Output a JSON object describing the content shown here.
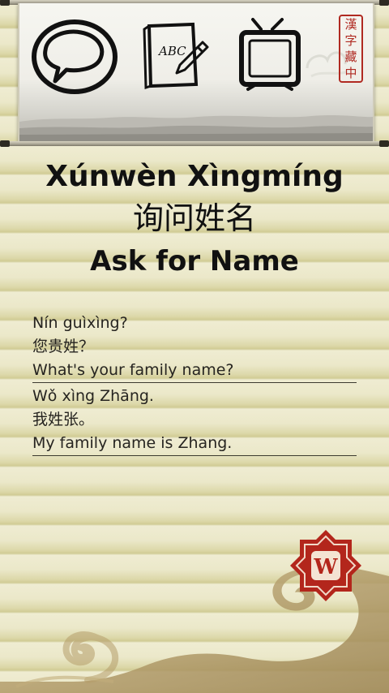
{
  "app": {
    "tabs": [
      {
        "name": "conversation-tab",
        "icon": "speech-bubble-icon"
      },
      {
        "name": "writing-tab",
        "icon": "brush-notebook-icon",
        "label": "ABC"
      },
      {
        "name": "video-tab",
        "icon": "tv-icon"
      }
    ],
    "seal_chars": [
      "漢",
      "字",
      "藏",
      "中"
    ],
    "colors": {
      "paper": "#e9e6c6",
      "ink": "#1a1a1a",
      "seal_red": "#b02a22",
      "cloud_gold": "#b49d6a"
    }
  },
  "lesson": {
    "title_pinyin": "Xúnwèn Xìngmíng",
    "title_hanzi": "询问姓名",
    "title_english": "Ask for Name"
  },
  "dialogue": [
    {
      "pinyin": "Nín guìxìng?",
      "hanzi": "您贵姓？",
      "english": "What's your family name?"
    },
    {
      "pinyin": "Wǒ xìng Zhāng.",
      "hanzi": "我姓张。",
      "english": "My family name is Zhang."
    }
  ],
  "logo": {
    "icon": "app-logo-icon",
    "letter": "W"
  }
}
